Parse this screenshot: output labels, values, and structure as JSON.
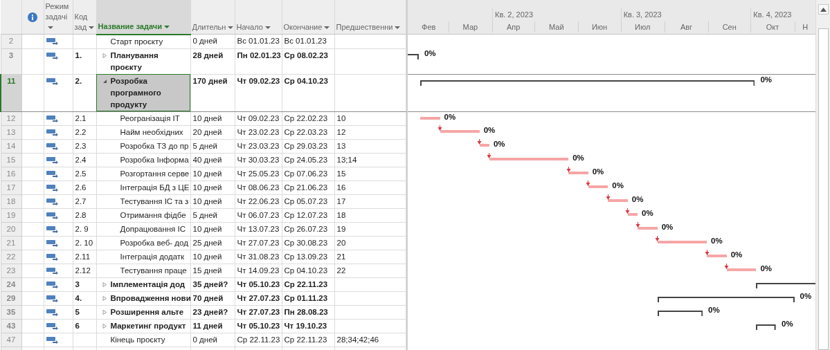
{
  "columns": [
    {
      "label": "Режим задачі",
      "selected": false
    },
    {
      "label": "Код зад",
      "selected": false
    },
    {
      "label": "Название задачи",
      "selected": true
    },
    {
      "label": "Длительн",
      "selected": false
    },
    {
      "label": "Начало",
      "selected": false
    },
    {
      "label": "Окончание",
      "selected": false
    },
    {
      "label": "Предшественни",
      "selected": false
    }
  ],
  "timescale": {
    "quarters": [
      "Кв. 2, 2023",
      "Кв. 3, 2023",
      "Кв. 4, 2023"
    ],
    "months": [
      "Фев",
      "Мар",
      "Апр",
      "Май",
      "Июн",
      "Июл",
      "Авг",
      "Сен",
      "Окт",
      "Н"
    ]
  },
  "rows": [
    {
      "id": "2",
      "kind": "milestone",
      "selected": false,
      "name": "Старт проєкту",
      "duration": "0 дней",
      "start": "Вс 01.01.23",
      "finish": "Вс 01.01.23"
    },
    {
      "id": "3",
      "kind": "summary",
      "selected": false,
      "expanded": false,
      "code": "1.",
      "wrapped": true,
      "name": "Планування проєкту",
      "duration": "28 дней",
      "start": "Пн 02.01.23",
      "finish": "Ср 08.02.23",
      "gantt_label": "0%"
    },
    {
      "id": "11",
      "kind": "summary",
      "selected": true,
      "expanded": true,
      "code": "2.",
      "wrapped": true,
      "name": "Розробка програмного продукту",
      "duration": "170 дней",
      "start": "Чт 09.02.23",
      "finish": "Ср 04.10.23",
      "gantt_label": "0%",
      "children": [
        {
          "id": "12",
          "kind": "task",
          "selected": false,
          "code": "2.1",
          "name": "Реогранізація ІТ",
          "duration": "10 дней",
          "start": "Чт 09.02.23",
          "finish": "Ср 22.02.23",
          "predecessors": "10",
          "gantt_label": "0%"
        },
        {
          "id": "13",
          "kind": "task",
          "selected": false,
          "code": "2.2",
          "name": "Найм необхідних",
          "duration": "20 дней",
          "start": "Чт 23.02.23",
          "finish": "Ср 22.03.23",
          "predecessors": "12",
          "gantt_label": "0%"
        },
        {
          "id": "14",
          "kind": "task",
          "selected": false,
          "code": "2.3",
          "name": "Розробка ТЗ до пр",
          "duration": "5 дней",
          "start": "Чт 23.03.23",
          "finish": "Ср 29.03.23",
          "predecessors": "13",
          "gantt_label": "0%"
        },
        {
          "id": "15",
          "kind": "task",
          "selected": false,
          "code": "2.4",
          "name": "Розробка Інформа",
          "duration": "40 дней",
          "start": "Чт 30.03.23",
          "finish": "Ср 24.05.23",
          "predecessors": "13;14",
          "gantt_label": "0%"
        },
        {
          "id": "16",
          "kind": "task",
          "selected": false,
          "code": "2.5",
          "name": "Розгортання серве",
          "duration": "10 дней",
          "start": "Чт 25.05.23",
          "finish": "Ср 07.06.23",
          "predecessors": "15",
          "gantt_label": "0%"
        },
        {
          "id": "17",
          "kind": "task",
          "selected": false,
          "code": "2.6",
          "name": "Інтеграція БД з ЦЕ",
          "duration": "10 дней",
          "start": "Чт 08.06.23",
          "finish": "Ср 21.06.23",
          "predecessors": "16",
          "gantt_label": "0%"
        },
        {
          "id": "18",
          "kind": "task",
          "selected": false,
          "code": "2.7",
          "name": "Тестування ІС та з",
          "duration": "10 дней",
          "start": "Чт 22.06.23",
          "finish": "Ср 05.07.23",
          "predecessors": "17",
          "gantt_label": "0%"
        },
        {
          "id": "19",
          "kind": "task",
          "selected": false,
          "code": "2.8",
          "name": "Отримання фідбе",
          "duration": "5 дней",
          "start": "Чт 06.07.23",
          "finish": "Ср 12.07.23",
          "predecessors": "18",
          "gantt_label": "0%"
        },
        {
          "id": "20",
          "kind": "task",
          "selected": false,
          "code": "2. 9",
          "name": "Допрацювання ІС",
          "duration": "10 дней",
          "start": "Чт 13.07.23",
          "finish": "Ср 26.07.23",
          "predecessors": "19",
          "gantt_label": "0%"
        },
        {
          "id": "21",
          "kind": "task",
          "selected": false,
          "code": "2. 10",
          "name": "Розробка веб- дод",
          "duration": "25 дней",
          "start": "Чт 27.07.23",
          "finish": "Ср 30.08.23",
          "predecessors": "20",
          "gantt_label": "0%"
        },
        {
          "id": "22",
          "kind": "task",
          "selected": false,
          "code": "2.11",
          "name": "Інтеграція додатк",
          "duration": "10 дней",
          "start": "Чт 31.08.23",
          "finish": "Ср 13.09.23",
          "predecessors": "21",
          "gantt_label": "0%"
        },
        {
          "id": "23",
          "kind": "task",
          "selected": false,
          "code": "2.12",
          "name": "Тестування праце",
          "duration": "15 дней",
          "start": "Чт 14.09.23",
          "finish": "Ср 04.10.23",
          "predecessors": "22",
          "gantt_label": "0%"
        }
      ]
    },
    {
      "id": "24",
      "kind": "summary",
      "selected": false,
      "expanded": false,
      "code": "3",
      "name": "Імплементація дод",
      "duration": "35 дней?",
      "start": "Чт 05.10.23",
      "finish": "Ср 22.11.23"
    },
    {
      "id": "29",
      "kind": "summary",
      "selected": false,
      "expanded": false,
      "code": "4.",
      "name": "Впровадження нови",
      "duration": "70 дней",
      "start": "Чт 27.07.23",
      "finish": "Ср 01.11.23",
      "gantt_label": "0%"
    },
    {
      "id": "35",
      "kind": "summary",
      "selected": false,
      "expanded": false,
      "code": "5",
      "name": "Розширення альте",
      "duration": "23 дней?",
      "start": "Чт 27.07.23",
      "finish": "Пн 28.08.23",
      "gantt_label": "0%"
    },
    {
      "id": "43",
      "kind": "summary",
      "selected": false,
      "expanded": false,
      "code": "6",
      "name": "Маркетинг продукт",
      "duration": "11 дней",
      "start": "Чт 05.10.23",
      "finish": "Чт 19.10.23",
      "gantt_label": "0%"
    },
    {
      "id": "47",
      "kind": "milestone",
      "selected": false,
      "name": "Кінець проєкту",
      "duration": "0 дней",
      "start": "Ср 22.11.23",
      "finish": "Ср 22.11.23",
      "predecessors": "28;34;42;46"
    }
  ]
}
